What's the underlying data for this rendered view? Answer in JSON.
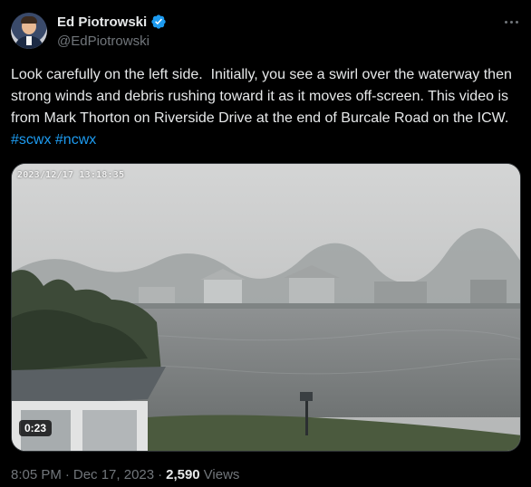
{
  "author": {
    "display_name": "Ed Piotrowski",
    "handle": "@EdPiotrowski",
    "verified": true,
    "verified_color": "#1d9bf0"
  },
  "tweet": {
    "text": "Look carefully on the left side.  Initially, you see a swirl over the waterway then strong winds and debris rushing toward it as it moves off-screen. This video is from Mark Thorton on Riverside Drive at the end of Burcale Road on the ICW. ",
    "hashtags": [
      "#scwx",
      "#ncwx"
    ]
  },
  "media": {
    "camera_timestamp": "2023/12/17 13:18:35",
    "duration": "0:23"
  },
  "meta": {
    "time": "8:05 PM",
    "separator": "·",
    "date": "Dec 17, 2023",
    "views_count": "2,590",
    "views_label": "Views"
  },
  "icons": [
    "verified-badge-icon",
    "more-options-icon"
  ],
  "colors": {
    "background": "#000000",
    "link": "#1d9bf0",
    "muted": "#71767b",
    "text": "#e7e9ea"
  }
}
